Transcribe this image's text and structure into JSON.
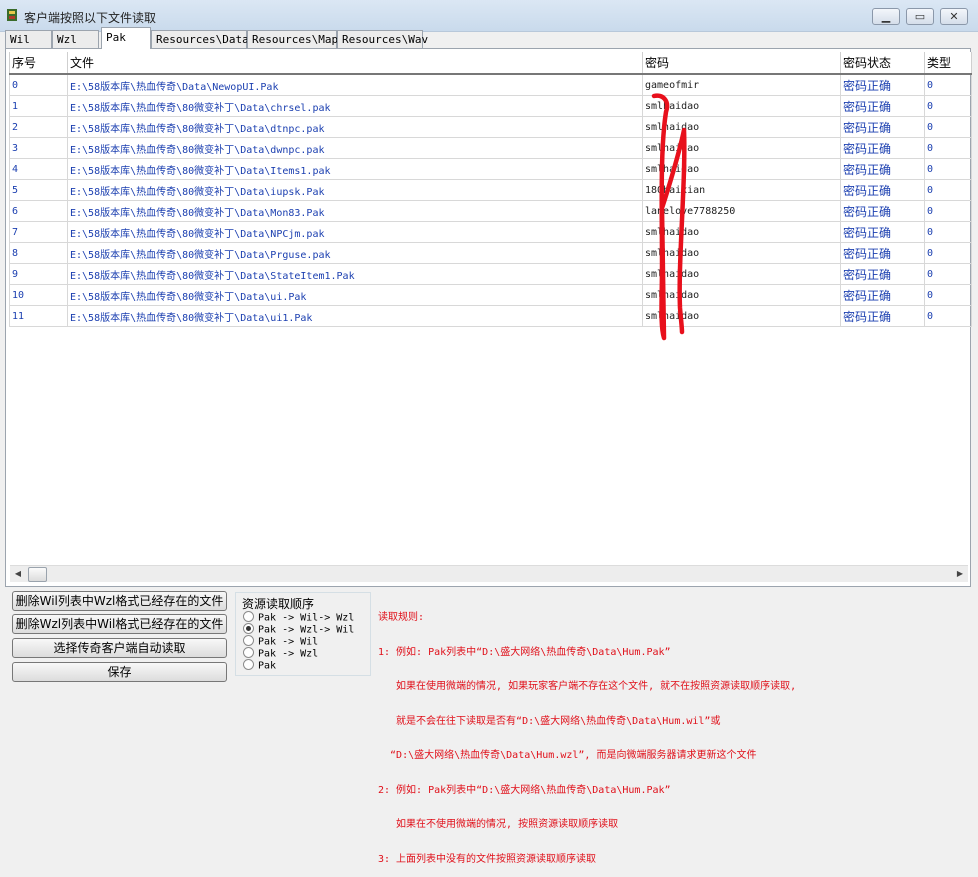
{
  "window": {
    "title": "客户端按照以下文件读取"
  },
  "tabs": [
    "Wil",
    "Wzl",
    "Pak",
    "Resources\\Data",
    "Resources\\Map",
    "Resources\\Wav"
  ],
  "table": {
    "headers": [
      "序号",
      "文件",
      "密码",
      "密码状态",
      "类型"
    ],
    "rows": [
      [
        "0",
        "E:\\58版本库\\热血传奇\\Data\\NewopUI.Pak",
        "gameofmir",
        "密码正确",
        "0"
      ],
      [
        "1",
        "E:\\58版本库\\热血传奇\\80微变补丁\\Data\\chrsel.pak",
        "smlhaidao",
        "密码正确",
        "0"
      ],
      [
        "2",
        "E:\\58版本库\\热血传奇\\80微变补丁\\Data\\dtnpc.pak",
        "smlhaidao",
        "密码正确",
        "0"
      ],
      [
        "3",
        "E:\\58版本库\\热血传奇\\80微变补丁\\Data\\dwnpc.pak",
        "smlhaidao",
        "密码正确",
        "0"
      ],
      [
        "4",
        "E:\\58版本库\\热血传奇\\80微变补丁\\Data\\Items1.pak",
        "smlhaidao",
        "密码正确",
        "0"
      ],
      [
        "5",
        "E:\\58版本库\\热血传奇\\80微变补丁\\Data\\iupsk.Pak",
        "180haixian",
        "密码正确",
        "0"
      ],
      [
        "6",
        "E:\\58版本库\\热血传奇\\80微变补丁\\Data\\Mon83.Pak",
        "lanelove7788250",
        "密码正确",
        "0"
      ],
      [
        "7",
        "E:\\58版本库\\热血传奇\\80微变补丁\\Data\\NPCjm.pak",
        "smlhaidao",
        "密码正确",
        "0"
      ],
      [
        "8",
        "E:\\58版本库\\热血传奇\\80微变补丁\\Data\\Prguse.pak",
        "smlhaidao",
        "密码正确",
        "0"
      ],
      [
        "9",
        "E:\\58版本库\\热血传奇\\80微变补丁\\Data\\StateItem1.Pak",
        "smlhaidao",
        "密码正确",
        "0"
      ],
      [
        "10",
        "E:\\58版本库\\热血传奇\\80微变补丁\\Data\\ui.Pak",
        "smlhaidao",
        "密码正确",
        "0"
      ],
      [
        "11",
        "E:\\58版本库\\热血传奇\\80微变补丁\\Data\\ui1.Pak",
        "smlhaidao",
        "密码正确",
        "0"
      ]
    ]
  },
  "buttons": {
    "delete_wil": "删除Wil列表中Wzl格式已经存在的文件",
    "delete_wzl": "删除Wzl列表中Wil格式已经存在的文件",
    "select_client": "选择传奇客户端自动读取",
    "save": "保存"
  },
  "order_group": {
    "title": "资源读取顺序",
    "options": [
      "Pak -> Wil-> Wzl",
      "Pak -> Wzl-> Wil",
      "Pak -> Wil",
      "Pak -> Wzl",
      "Pak"
    ],
    "selected_index": 1
  },
  "rules": {
    "lines": [
      "读取规则:",
      "1: 例如: Pak列表中“D:\\盛大网络\\热血传奇\\Data\\Hum.Pak”",
      "   如果在使用微端的情况, 如果玩家客户端不存在这个文件, 就不在按照资源读取顺序读取,",
      "   就是不会在往下读取是否有“D:\\盛大网络\\热血传奇\\Data\\Hum.wil”或",
      "  “D:\\盛大网络\\热血传奇\\Data\\Hum.wzl”, 而是向微端服务器请求更新这个文件",
      "2: 例如: Pak列表中“D:\\盛大网络\\热血传奇\\Data\\Hum.Pak”",
      "   如果在不使用微端的情况, 按照资源读取顺序读取",
      "3: 上面列表中没有的文件按照资源读取顺序读取"
    ]
  },
  "colors": {
    "path_text": "#1b3fb0",
    "rules_text": "#e0101a",
    "annotation": "#e8101c"
  }
}
